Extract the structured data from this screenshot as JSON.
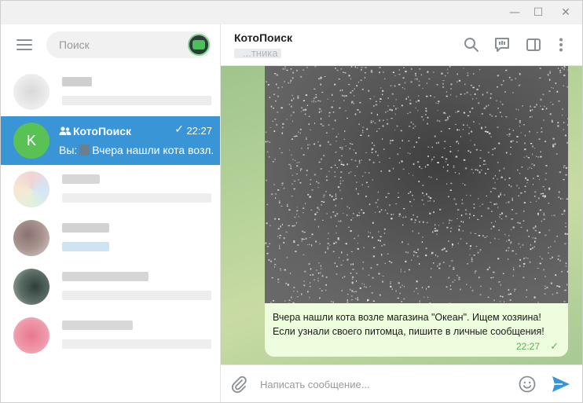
{
  "window": {
    "minimize_glyph": "—",
    "maximize_glyph": "☐",
    "close_glyph": "✕"
  },
  "sidebar": {
    "search_placeholder": "Поиск",
    "active_chat": {
      "avatar_letter": "K",
      "name": "КотоПоиск",
      "time": "22:27",
      "preview_prefix": "Вы:",
      "preview_text": "Вчера нашли кота возл..."
    }
  },
  "header": {
    "title": "КотоПоиск",
    "subtitle": "...тника"
  },
  "message": {
    "text": "Вчера нашли кота возле магазина \"Океан\". Ищем хозяина! Если узнали своего питомца, пишите в личные сообщения!",
    "time": "22:27"
  },
  "composer": {
    "placeholder": "Написать сообщение..."
  },
  "icons": {
    "menu": "hamburger-menu-icon",
    "search": "search-icon",
    "comments": "comments-icon",
    "sidebar_toggle": "sidebar-panel-icon",
    "more": "more-vertical-icon",
    "attach": "paperclip-icon",
    "emoji": "emoji-icon",
    "send": "send-icon"
  },
  "colors": {
    "accent": "#3a95d6",
    "avatar": "#5ac154",
    "bubble": "#eefdde",
    "read_check": "#5fae55",
    "send": "#3a95d6"
  }
}
